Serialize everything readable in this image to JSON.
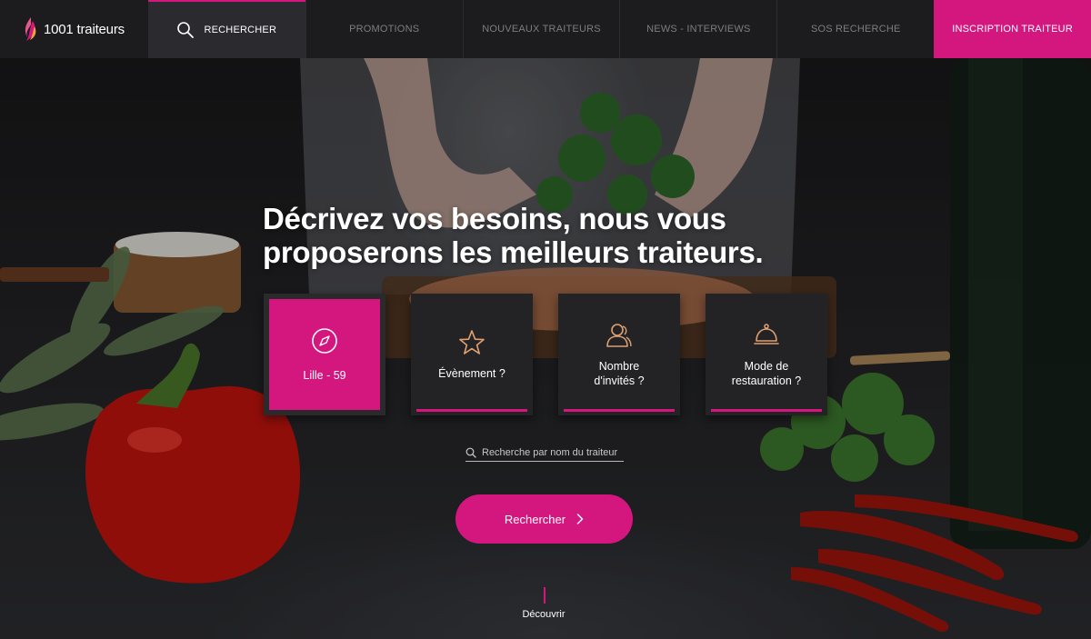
{
  "brand": {
    "name": "1001 traiteurs"
  },
  "nav": {
    "search_label": "RECHERCHER",
    "items": [
      "PROMOTIONS",
      "NOUVEAUX TRAITEURS",
      "NEWS - INTERVIEWS",
      "SOS RECHERCHE"
    ],
    "cta_label": "INSCRIPTION TRAITEUR"
  },
  "hero": {
    "headline_line1": "Décrivez vos besoins, nous vous",
    "headline_line2": "proposerons les meilleurs traiteurs.",
    "cards": [
      {
        "label": "Lille - 59",
        "icon": "compass-icon",
        "active": true
      },
      {
        "label": "Évènement ?",
        "icon": "star-icon",
        "active": false
      },
      {
        "label_line1": "Nombre",
        "label_line2": "d'invités ?",
        "icon": "guests-icon",
        "active": false
      },
      {
        "label_line1": "Mode de",
        "label_line2": "restauration ?",
        "icon": "cloche-icon",
        "active": false
      }
    ],
    "search_placeholder": "Recherche par nom du traiteur",
    "button_label": "Rechercher",
    "discover_label": "Découvrir"
  },
  "colors": {
    "accent": "#d4177f",
    "nav_bg": "#1c1c1f",
    "card_bg": "#232326",
    "icon_accent": "#e0a070"
  }
}
